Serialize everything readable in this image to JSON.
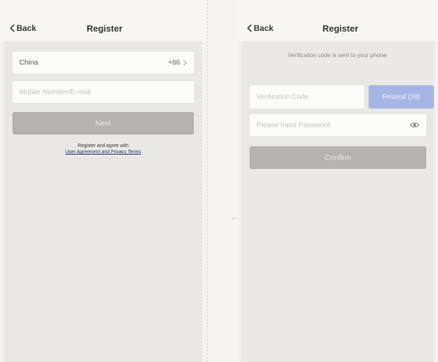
{
  "left": {
    "back_label": "Back",
    "title": "Register",
    "country": {
      "name": "China",
      "code": "+86"
    },
    "account_input": {
      "placeholder": "Mobile Number/E-mail"
    },
    "next_label": "Next",
    "terms_prefix": "Register and agree with",
    "terms_link": "User Agreement and Privacy Terms"
  },
  "right": {
    "back_label": "Back",
    "title": "Register",
    "info_text": "Verification code is sent to your phone:",
    "code_input": {
      "placeholder": "Verification Code"
    },
    "resend_label": "Resend (39)",
    "password_input": {
      "placeholder": "Please Input Password"
    },
    "confirm_label": "Confirm"
  },
  "icons": {
    "back": "chevron-left-icon",
    "country_arrow": "chevron-right-icon",
    "password_toggle": "eye-icon"
  },
  "colors": {
    "button_disabled": "#b4b3b0",
    "resend_button": "#a6b5e6",
    "link": "#1e2b5a"
  }
}
